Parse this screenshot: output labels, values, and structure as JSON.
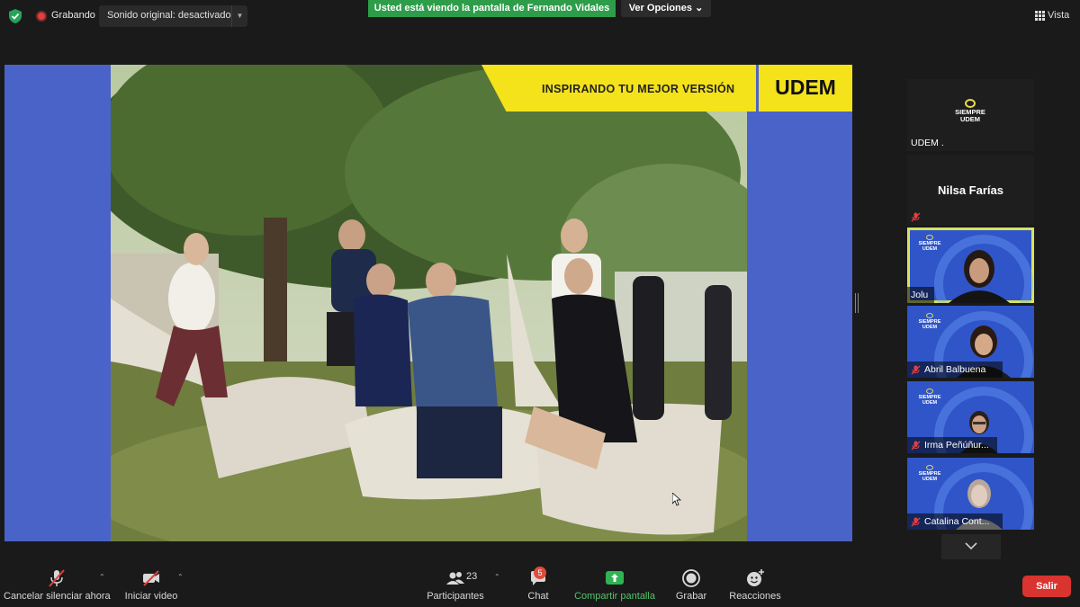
{
  "topbar": {
    "recording_label": "Grabando",
    "sound_label": "Sonido original: desactivado",
    "viewing_banner": "Usted está viendo la pantalla de Fernando Vidales",
    "options_label": "Ver Opciones",
    "view_label": "Vista"
  },
  "shared_screen": {
    "banner_text": "INSPIRANDO TU MEJOR VERSIÓN",
    "brand": "UDEM"
  },
  "gallery": {
    "logo_lines": [
      "SIEMPRE",
      "UDEM"
    ],
    "tiles": [
      {
        "name": "UDEM .",
        "type": "logo",
        "muted": false
      },
      {
        "name": "Nilsa Farías",
        "type": "name-only",
        "muted": true
      },
      {
        "name": "Jolu",
        "type": "video",
        "muted": false,
        "active_speaker": true
      },
      {
        "name": "Abril Balbuena",
        "type": "video",
        "muted": true
      },
      {
        "name": "Irma Peñúñur...",
        "type": "video",
        "muted": true
      },
      {
        "name": "Catalina Cont...",
        "type": "video",
        "muted": true
      }
    ]
  },
  "toolbar": {
    "unmute_label": "Cancelar silenciar ahora",
    "video_label": "Iniciar video",
    "participants_label": "Participantes",
    "participants_count": "23",
    "chat_label": "Chat",
    "chat_badge": "5",
    "share_label": "Compartir pantalla",
    "record_label": "Grabar",
    "reactions_label": "Reacciones",
    "leave_label": "Salir"
  },
  "colors": {
    "accent_green": "#2e9d4a",
    "leave_red": "#d9342f",
    "udem_yellow": "#f4e21a",
    "slide_blue": "#4a63c8"
  }
}
